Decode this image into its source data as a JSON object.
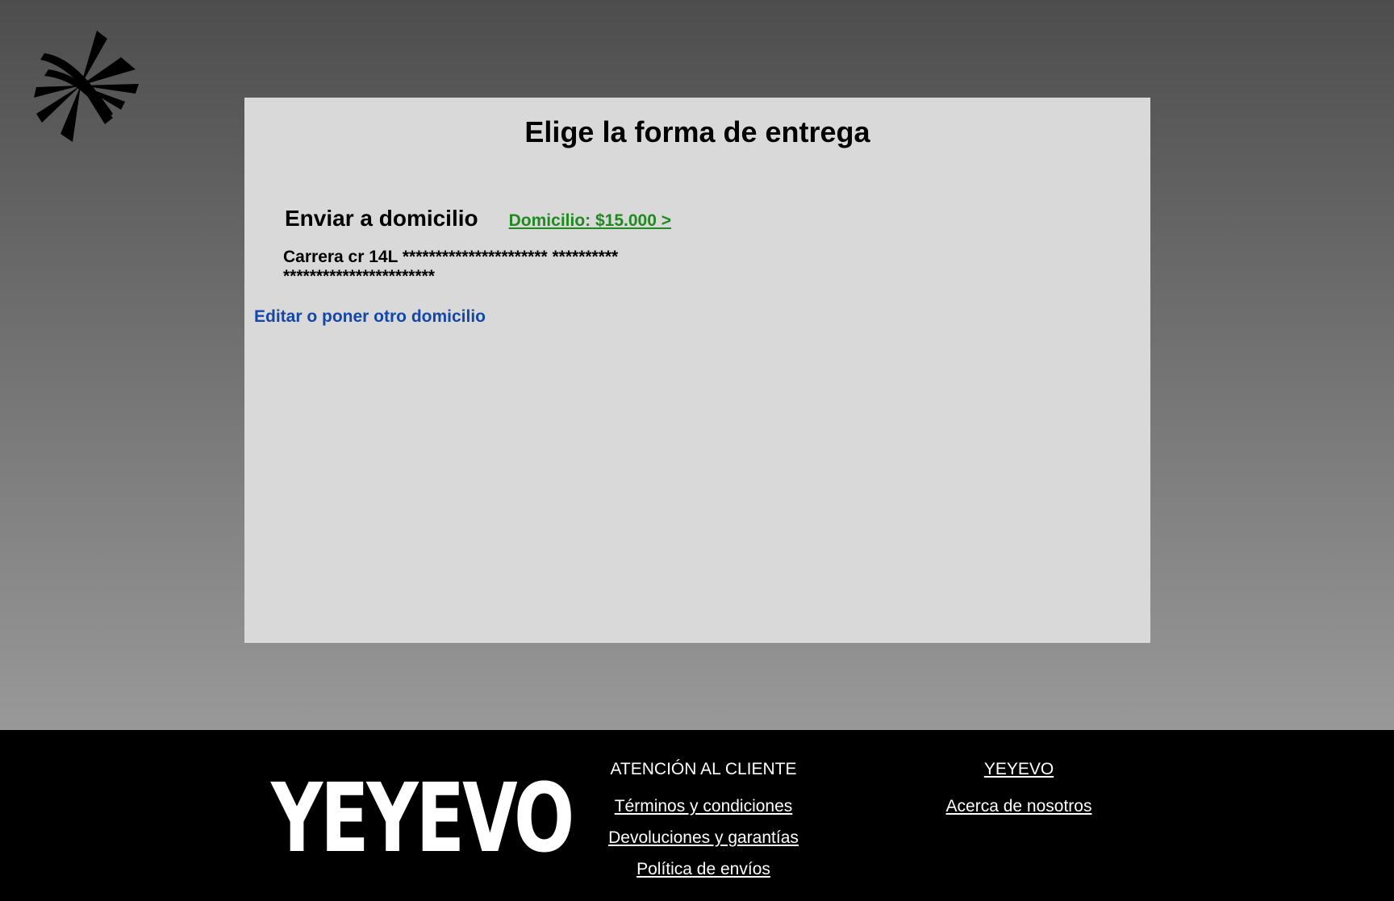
{
  "brand": {
    "logo_icon": "yeyevo-star-icon",
    "name": "YEYEVO"
  },
  "delivery": {
    "title": "Elige la forma de entrega",
    "option_title": "Enviar a domicilio",
    "shipping_cost_link": "Domicilio: $15.000 >",
    "address": "Carrera cr 14L ********************** *********************************",
    "edit_link": "Editar o poner otro domicilio"
  },
  "footer": {
    "logo_text": "YEYEVO",
    "customer_service": {
      "heading": "ATENCIÓN AL CLIENTE",
      "links": [
        "Términos y condiciones",
        "Devoluciones y garantías",
        "Política de envíos"
      ]
    },
    "company": {
      "heading": "YEYEVO",
      "links": [
        "Acerca de nosotros"
      ]
    }
  },
  "colors": {
    "panel_bg": "#d9d9d9",
    "shipping_link": "#1f8a1f",
    "edit_link": "#1447a8",
    "footer_bg": "#000000"
  }
}
